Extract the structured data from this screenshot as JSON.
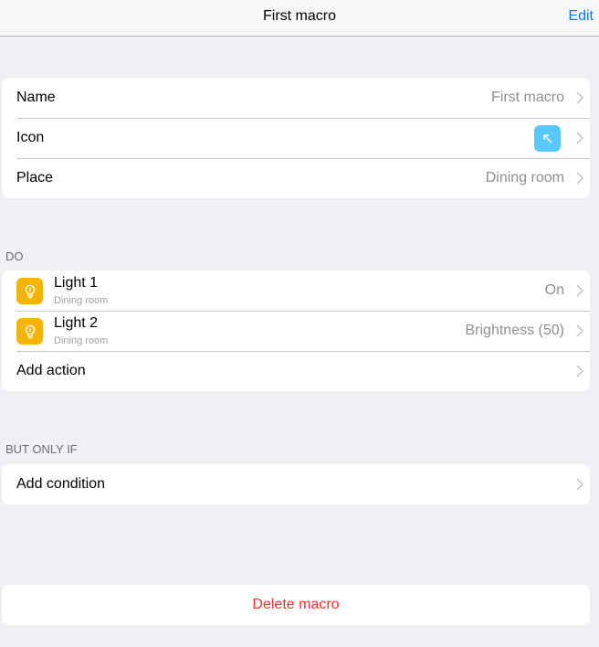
{
  "nav": {
    "title": "First macro",
    "edit_label": "Edit"
  },
  "general": {
    "name_label": "Name",
    "name_value": "First macro",
    "icon_label": "Icon",
    "icon_name": "arrow-up-left-icon",
    "place_label": "Place",
    "place_value": "Dining room"
  },
  "do_section": {
    "header": "DO",
    "actions": [
      {
        "name": "Light 1",
        "place": "Dining room",
        "value": "On",
        "icon": "lightbulb-icon"
      },
      {
        "name": "Light 2",
        "place": "Dining room",
        "value": "Brightness (50)",
        "icon": "lightbulb-icon"
      }
    ],
    "add_action_label": "Add action"
  },
  "condition_section": {
    "header": "BUT ONLY IF",
    "add_condition_label": "Add condition"
  },
  "delete_label": "Delete macro",
  "colors": {
    "accent": "#0a7aff",
    "icon_blue": "#5ac8fa",
    "bulb_yellow": "#f5b400",
    "destructive": "#ff2d2d",
    "background": "#efeff4"
  }
}
